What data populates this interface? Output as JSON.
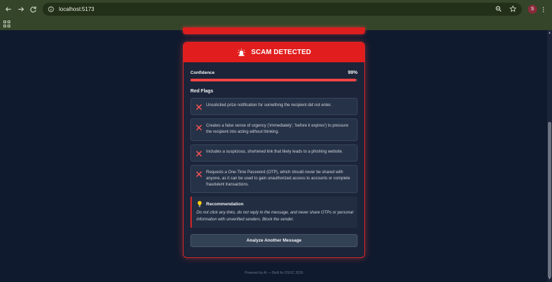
{
  "browser": {
    "url": "localhost:5173",
    "profile_initial": "S",
    "icons": {
      "back": "arrow-left-icon",
      "forward": "arrow-right-icon",
      "reload": "reload-icon",
      "info": "info-icon",
      "zoom": "zoom-icon",
      "bookmark": "star-icon",
      "menu": "kebab-icon",
      "apps": "apps-grid-icon"
    }
  },
  "result": {
    "title": "SCAM DETECTED",
    "confidence_label": "Confidence",
    "confidence_value": "99%",
    "confidence_fraction": 0.99,
    "red_flags_title": "Red Flags",
    "red_flags": [
      "Unsolicited prize notification for something the recipient did not enter.",
      "Creates a false sense of urgency ('immediately', 'before it expires') to pressure the recipient into acting without thinking.",
      "Includes a suspicious, shortened link that likely leads to a phishing website.",
      "Requests a One-Time Password (OTP), which should never be shared with anyone, as it can be used to gain unauthorized access to accounts or complete fraudulent transactions."
    ],
    "recommendation_title": "Recommendation",
    "recommendation_text": "Do not click any links, do not reply to the message, and never share OTPs or personal information with unverified senders. Block the sender.",
    "analyze_button": "Analyze Another Message"
  },
  "footer": "Powered by AI — Built for DSOC 2026",
  "colors": {
    "accent": "#e11d1d",
    "page_bg": "#101a2e",
    "card_bg": "#1b2438",
    "chrome": "#35452a"
  }
}
